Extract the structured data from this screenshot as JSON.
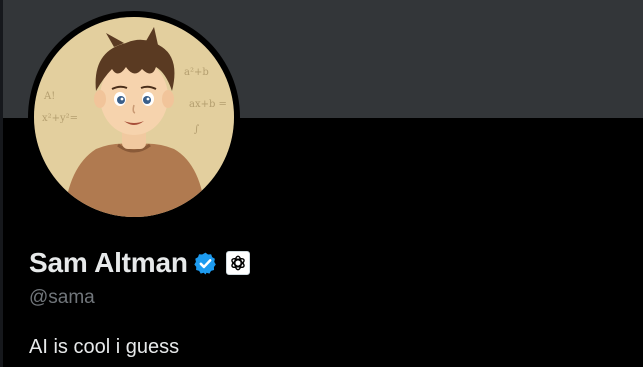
{
  "profile": {
    "display_name": "Sam Altman",
    "handle": "@sama",
    "bio": "AI is cool i guess",
    "verified": true,
    "affiliate_badge": "openai-logo-icon",
    "avatar": "cartoon-portrait-avatar"
  },
  "colors": {
    "page_background": "#000000",
    "banner": "#333639",
    "primary_text": "#e7e9ea",
    "secondary_text": "#71767b",
    "verified_blue": "#1d9bf0"
  },
  "avatar_art": {
    "chalkboard_notes": [
      "A!",
      "a²+b",
      "ax+b =",
      "x²+y²=",
      "∫"
    ]
  }
}
